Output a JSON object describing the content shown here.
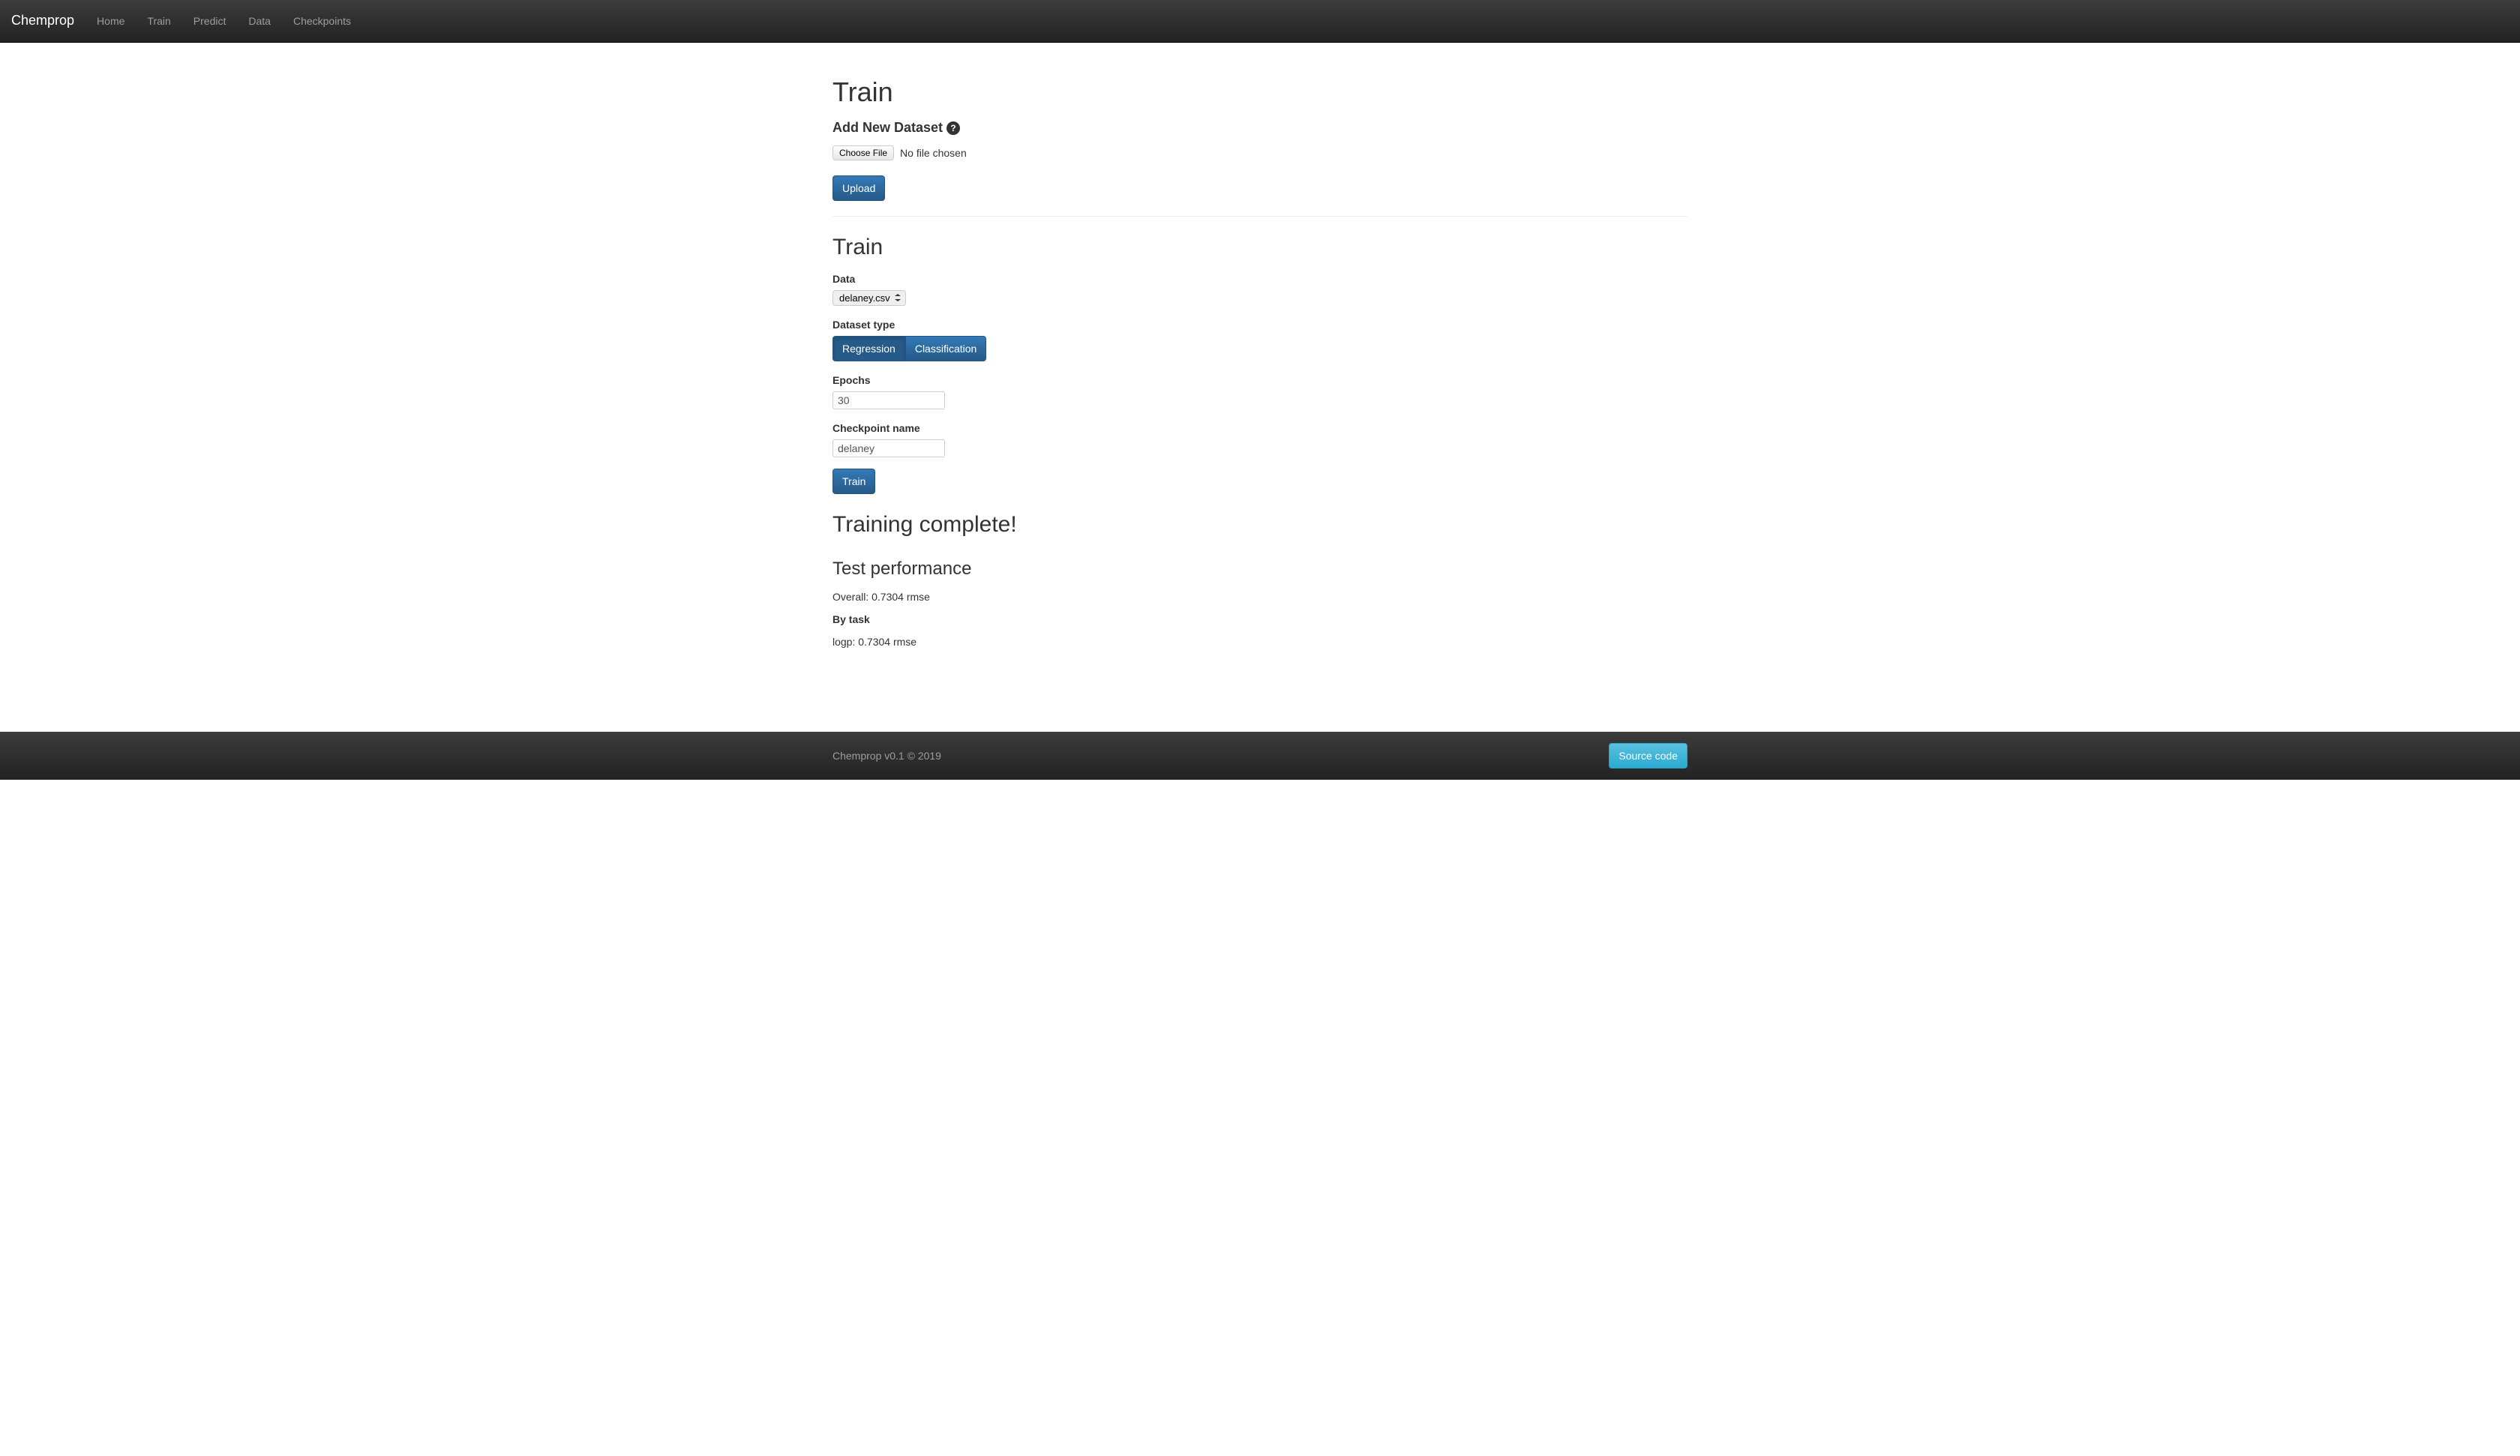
{
  "navbar": {
    "brand": "Chemprop",
    "items": [
      {
        "label": "Home"
      },
      {
        "label": "Train"
      },
      {
        "label": "Predict"
      },
      {
        "label": "Data"
      },
      {
        "label": "Checkpoints"
      }
    ]
  },
  "page": {
    "title": "Train"
  },
  "add_dataset": {
    "heading": "Add New Dataset",
    "file_button": "Choose File",
    "file_status": "No file chosen",
    "upload_button": "Upload"
  },
  "train_form": {
    "heading": "Train",
    "data_label": "Data",
    "data_selected": "delaney.csv",
    "dataset_type_label": "Dataset type",
    "dataset_types": [
      {
        "label": "Regression",
        "active": true
      },
      {
        "label": "Classification",
        "active": false
      }
    ],
    "epochs_label": "Epochs",
    "epochs_value": "30",
    "checkpoint_label": "Checkpoint name",
    "checkpoint_value": "delaney",
    "train_button": "Train"
  },
  "results": {
    "heading": "Training complete!",
    "test_perf_heading": "Test performance",
    "overall": "Overall: 0.7304 rmse",
    "by_task_heading": "By task",
    "tasks": [
      "logp: 0.7304 rmse"
    ]
  },
  "footer": {
    "text": "Chemprop v0.1 © 2019",
    "source_button": "Source code"
  }
}
